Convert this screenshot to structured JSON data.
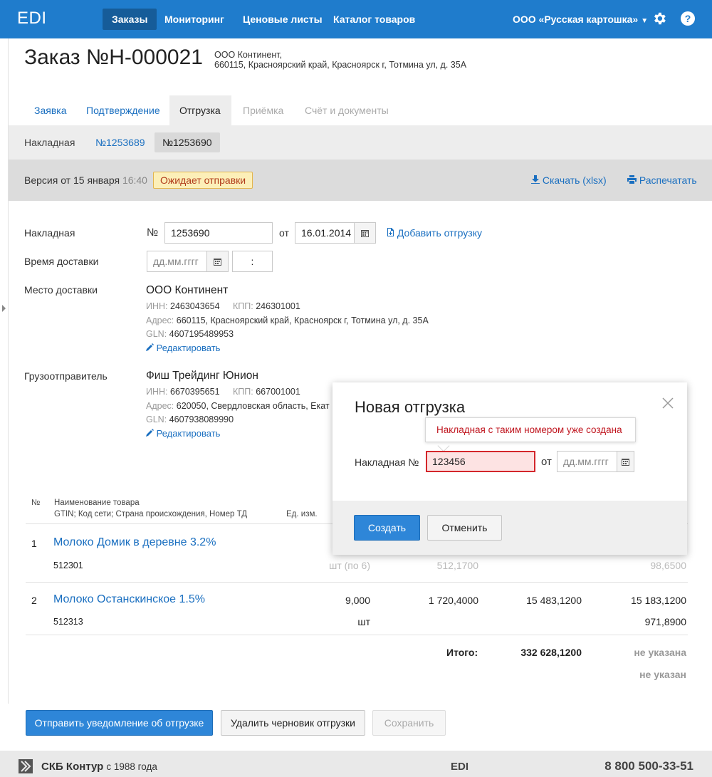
{
  "app": {
    "logo": "EDI",
    "nav": [
      "Заказы",
      "Мониторинг",
      "Ценовые листы",
      "Каталог товаров"
    ],
    "company": "ООО «Русская картошка»"
  },
  "order": {
    "title": "Заказ №Н-000021",
    "client_name": "ООО Континент,",
    "client_address": "660115, Красноярский край, Красноярск г, Тотмина ул, д. 35А"
  },
  "tabs": [
    "Заявка",
    "Подтверждение",
    "Отгрузка",
    "Приёмка",
    "Счёт и документы"
  ],
  "subtabs": {
    "label": "Накладная",
    "items": [
      "№1253689",
      "№1253690"
    ]
  },
  "version": {
    "prefix": "Версия от ",
    "date": "15 января",
    "time": "16:40",
    "status": "Ожидает отправки",
    "download": "Скачать (xlsx)",
    "print": "Распечатать"
  },
  "form": {
    "invoice_label": "Накладная",
    "num_sign": "№",
    "invoice_number": "1253690",
    "from_label": "от",
    "invoice_date": "16.01.2014",
    "add_shipment": "Добавить отгрузку",
    "delivery_time_label": "Время доставки",
    "date_placeholder": "дд.мм.гггг",
    "time_placeholder": ":",
    "delivery_place_label": "Место доставки",
    "edit": "Редактировать"
  },
  "delivery_org": {
    "name": "ООО Континент",
    "inn_label": "ИНН:",
    "inn": "2463043654",
    "kpp_label": "КПП:",
    "kpp": "246301001",
    "address_label": "Адрес:",
    "address": "660115, Красноярский край, Красноярск г, Тотмина ул, д. 35А",
    "gln_label": "GLN:",
    "gln": "4607195489953"
  },
  "shipper": {
    "label": "Грузоотправитель",
    "name": "Фиш Трейдинг Юнион",
    "inn_label": "ИНН:",
    "inn": "6670395651",
    "kpp_label": "КПП:",
    "kpp": "667001001",
    "address_label": "Адрес:",
    "address": "620050, Свердловская область, Екат",
    "gln_label": "GLN:",
    "gln": "4607938089990"
  },
  "table": {
    "col_num": "№",
    "col_name": "Наименование товара",
    "col_name_sub": "GTIN; Код сети; Страна происхождения, Номер ТД",
    "col_unit": "Ед. изм.",
    "rows": [
      {
        "num": "1",
        "name": "Молоко Домик в деревне 3.2%",
        "code": "512301",
        "qty": "",
        "unit": "шт (по 6)",
        "price": "512,1700",
        "sum": "",
        "vat_total": "",
        "vat": "98,6500"
      },
      {
        "num": "2",
        "name": "Молоко Останскинское 1.5%",
        "code": "512313",
        "qty": "9,000",
        "unit": "шт",
        "price": "1 720,4000",
        "sum": "15 483,1200",
        "vat_total": "15 183,1200",
        "vat": "971,8900"
      }
    ],
    "total_label": "Итого:",
    "total_sum": "332 628,1200",
    "not_set_1": "не указана",
    "not_set_2": "не указан"
  },
  "buttons": {
    "send": "Отправить уведомление об отгрузке",
    "delete": "Удалить черновик отгрузки",
    "save": "Сохранить"
  },
  "modal": {
    "title": "Новая отгрузка",
    "error": "Накладная с таким номером уже создана",
    "invoice_label": "Накладная №",
    "invoice_value": "123456",
    "from_label": "от",
    "date_placeholder": "дд.мм.гггг",
    "create": "Создать",
    "cancel": "Отменить"
  },
  "footer": {
    "brand": "СКБ Контур",
    "since": "с 1988 года",
    "center": "EDI",
    "phone": "8 800 500-33-51"
  },
  "colors": {
    "brand_blue": "#1f7ccc",
    "link": "#1a6fc0",
    "error": "#d3262b",
    "status_bg": "#fcefb8"
  }
}
